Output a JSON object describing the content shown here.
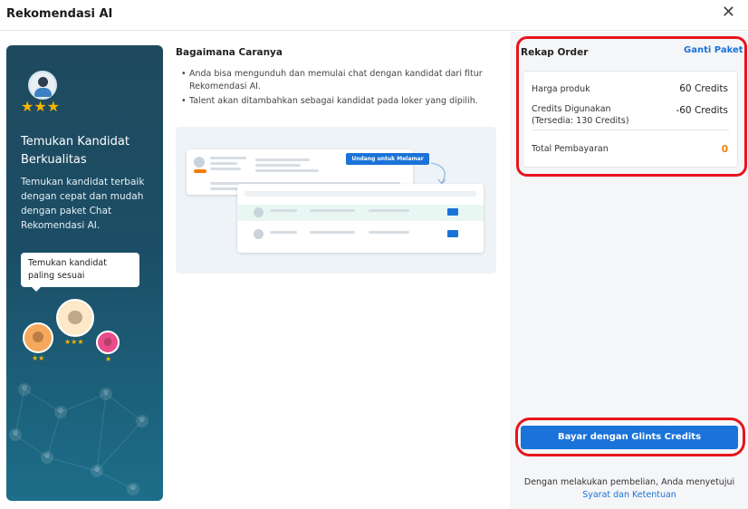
{
  "dialog": {
    "title": "Rekomendasi AI",
    "close_glyph": "✕"
  },
  "promo": {
    "stars_top": "★★★",
    "heading": "Temukan Kandidat Berkualitas",
    "body": "Temukan kandidat terbaik dengan cepat dan mudah dengan paket Chat Rekomendasi AI.",
    "tooltip": "Temukan kandidat paling sesuai",
    "stars_a": "★★",
    "stars_b": "★★★",
    "stars_c": "★"
  },
  "how": {
    "title": "Bagaimana Caranya",
    "steps": [
      "Anda bisa mengunduh dan memulai chat dengan kandidat dari fitur Rekomendasi AI.",
      "Talent akan ditambahkan sebagai kandidat pada loker yang dipilih."
    ],
    "illustration_button": "Undang untuk Melamar"
  },
  "rekap": {
    "title": "Rekap Order",
    "change_plan": "Ganti Paket",
    "rows": {
      "price_label": "Harga produk",
      "price_value": "60 Credits",
      "used_label": "Credits Digunakan",
      "used_sub": "(Tersedia: 130 Credits)",
      "used_value": "-60 Credits",
      "total_label": "Total Pembayaran",
      "total_value": "0"
    },
    "pay_button": "Bayar dengan Glints Credits",
    "terms_text": "Dengan melakukan pembelian, Anda menyetujui",
    "terms_link": "Syarat dan Ketentuan"
  },
  "colors": {
    "accent": "#1a73d9",
    "annotation": "#e8141c",
    "total": "#f57c00"
  }
}
